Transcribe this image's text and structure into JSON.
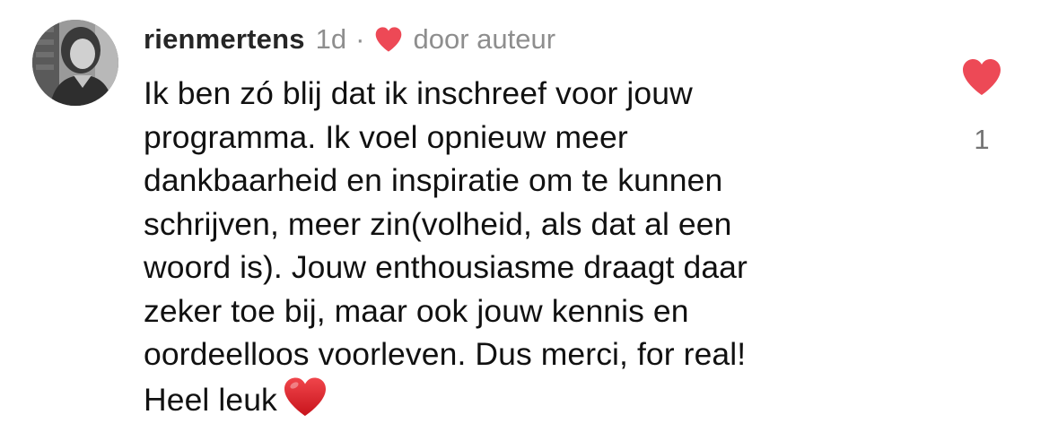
{
  "comment": {
    "username": "rienmertens",
    "time": "1d",
    "separator": "·",
    "author_like_label": "door auteur",
    "body_lines": [
      "Ik ben zó blij dat ik inschreef voor jouw",
      "programma. Ik voel opnieuw meer",
      "dankbaarheid en inspiratie om te kunnen",
      "schrijven, meer zin(volheid, als dat al een",
      "woord is). Jouw enthousiasme draagt daar",
      "zeker toe bij, maar ook jouw kennis en",
      "oordeelloos voorleven. Dus merci, for real!",
      "Heel leuk"
    ],
    "avatar_icon": "user-photo",
    "like_icon": "heart-filled-icon",
    "emoji_icon": "red-heart-emoji",
    "like_count": "1",
    "like_liked": true
  },
  "colors": {
    "heart_red": "#ED4956",
    "muted_text": "#8e8e8e",
    "username_text": "#262626",
    "body_text": "#111111",
    "emoji_red": "#E0272F"
  }
}
